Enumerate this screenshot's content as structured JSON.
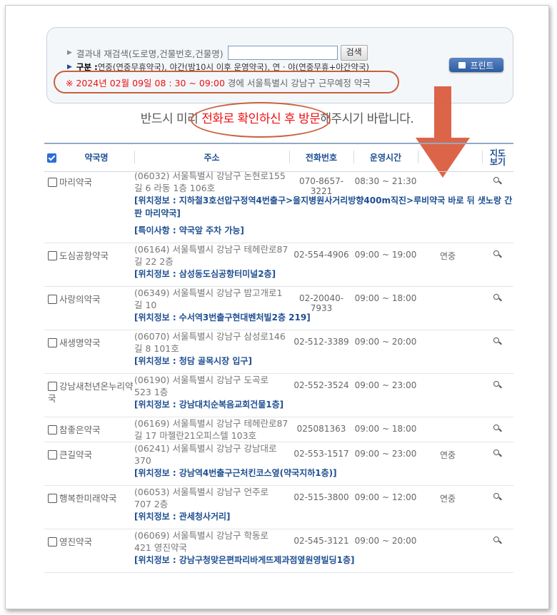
{
  "search": {
    "label": "결과내 재검색(도로명,건물번호,건물명)",
    "input_value": "",
    "button": "검색",
    "category_prefix": "구분 : ",
    "category_text": "연중(연중무휴약국), 야간(밤10시 이후 운영약국), 연 · 야(연중무휴+야간약국)",
    "date_text": "※ 2024년 02월 09일 08 : 30 ~ 09:00",
    "location_text": "경에  서울특별시  강남구  근무예정 약국",
    "print_button": "프린트"
  },
  "notice": {
    "before": "반드시 미리 ",
    "emphasis": "전화로 확인하신 후 방문",
    "after": "해주시기 바랍니다."
  },
  "table": {
    "headers": {
      "name": "약국명",
      "address": "주소",
      "phone": "전화번호",
      "hours": "운영시간",
      "map_line1": "지도",
      "map_line2": "보기"
    },
    "select_all_checked": true
  },
  "pharmacies": [
    {
      "name": "마리약국",
      "addr1": "(06032) 서울특별시 강남구 논현로155",
      "addr2": "길 6 라동 1층 106호",
      "phone": "070-8657-3221",
      "hours": "08:30 ~ 21:30",
      "ext": "",
      "info": [
        "[위치정보 : 지하철3호선압구정역4번출구>을지병원사거리방향400m직진>루비약국 바로 뒤 샛노랑 간판 마리약국]",
        "[특이사항 : 약국앞 주차 가능]"
      ]
    },
    {
      "name": "도심공항약국",
      "addr1": "(06164) 서울특별시 강남구 테헤란로87",
      "addr2": "길 22 2층",
      "phone": "02-554-4906",
      "hours": "09:00 ~ 19:00",
      "ext": "연중",
      "info": [
        "[위치정보 : 삼성동도심공항터미널2층]"
      ]
    },
    {
      "name": "사랑의약국",
      "addr1": "(06349) 서울특별시 강남구 밤고개로1",
      "addr2": "길 10",
      "phone": "02-20040-7933",
      "hours": "09:00 ~ 18:00",
      "ext": "",
      "info": [
        "[위치정보 : 수서역3번출구현대벤처빌2층 219]"
      ]
    },
    {
      "name": "새생명약국",
      "addr1": "(06070) 서울특별시 강남구 삼성로146",
      "addr2": "길 8 101호",
      "phone": "02-512-3389",
      "hours": "09:00 ~ 20:00",
      "ext": "",
      "info": [
        "[위치정보 : 청담 골목시장 입구]"
      ]
    },
    {
      "name": "강남새천년온누리약국",
      "addr1": "(06190) 서울특별시 강남구 도곡로",
      "addr2": "523 1층",
      "phone": "02-552-3524",
      "hours": "09:00 ~ 23:00",
      "ext": "",
      "info": [
        "[위치정보 : 강남대치순복음교회건물1층]"
      ]
    },
    {
      "name": "참좋은약국",
      "addr1": "(06169) 서울특별시 강남구 테헤란로87",
      "addr2": "길 17 마젤란21오피스텔 103호",
      "phone": "025081363",
      "hours": "09:00 ~ 18:00",
      "ext": "",
      "info": []
    },
    {
      "name": "큰길약국",
      "addr1": "(06241) 서울특별시 강남구 강남대로",
      "addr2": "370",
      "phone": "02-553-1517",
      "hours": "09:00 ~ 23:00",
      "ext": "연중",
      "info": [
        "[위치정보 : 강남역4번출구근처킨코스옆(약국지하1층)]"
      ]
    },
    {
      "name": "행복한미래약국",
      "addr1": "(06053) 서울특별시 강남구 언주로",
      "addr2": "707 2층",
      "phone": "02-515-3800",
      "hours": "09:00 ~ 12:00",
      "ext": "연중",
      "info": [
        "[위치정보 : 관세청사거리]"
      ]
    },
    {
      "name": "영진약국",
      "addr1": "(06069) 서울특별시 강남구 학동로",
      "addr2": "421 영진약국",
      "phone": "02-545-3121",
      "hours": "09:00 ~ 20:00",
      "ext": "",
      "info": [
        "[위치정보 : 강남구청맞은편파리바게뜨제과점옆원영빌딩1층]"
      ]
    }
  ]
}
